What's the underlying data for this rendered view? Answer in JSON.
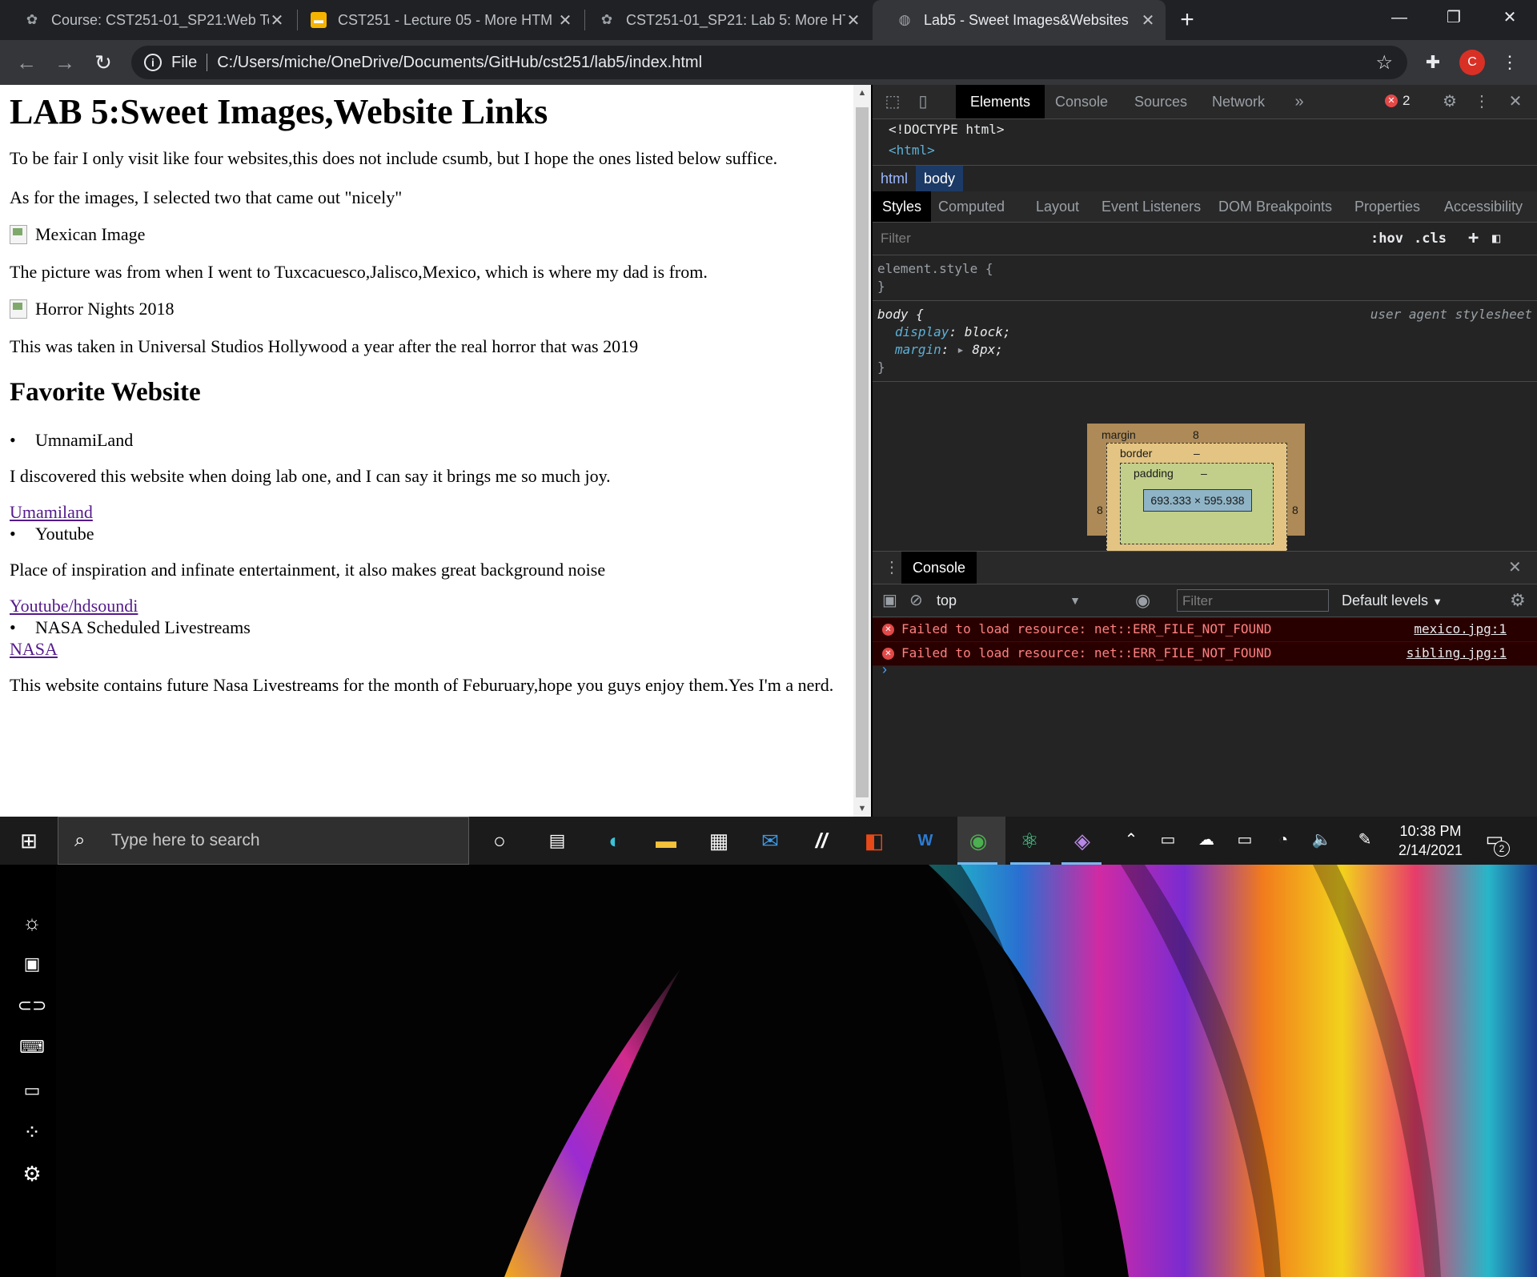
{
  "browser": {
    "tabs": [
      {
        "title": "Course: CST251-01_SP21:Web To",
        "icon": "csumb-logo-icon"
      },
      {
        "title": "CST251 - Lecture 05 - More HTM",
        "icon": "slides-icon"
      },
      {
        "title": "CST251-01_SP21: Lab 5: More HT",
        "icon": "csumb-logo-icon"
      },
      {
        "title": "Lab5 - Sweet Images&Websites",
        "icon": "globe-icon"
      }
    ],
    "address": {
      "scheme_label": "File",
      "url": "C:/Users/miche/OneDrive/Documents/GitHub/cst251/lab5/index.html"
    },
    "profile_initial": "C",
    "colors": {
      "tabstrip": "#202124",
      "toolbar": "#35363a",
      "avatar": "#d93025"
    }
  },
  "page": {
    "h1": "LAB 5:Sweet Images,Website Links",
    "intro1": "To be fair I only visit like four websites,this does not include csumb, but I hope the ones listed below suffice.",
    "intro2": "As for the images, I selected two that came out \"nicely\"",
    "img1_alt": "Mexican Image",
    "img1_caption": "The picture was from when I went to Tuxcacuesco,Jalisco,Mexico, which is where my dad is from.",
    "img2_alt": "Horror Nights 2018",
    "img2_caption": "This was taken in Universal Studios Hollywood a year after the real horror that was 2019",
    "h2": "Favorite Website",
    "sites": [
      {
        "name": "UmnamiLand",
        "desc": "I discovered this website when doing lab one, and I can say it brings me so much joy.",
        "link": "Umamiland"
      },
      {
        "name": "Youtube",
        "desc": "Place of inspiration and infinate entertainment, it also makes great background noise",
        "link": "Youtube/hdsoundi"
      },
      {
        "name": "NASA Scheduled Livestreams",
        "link": "NASA",
        "desc": "This website contains future Nasa Livestreams for the month of Feburuary,hope you guys enjoy them.Yes I'm a nerd."
      }
    ]
  },
  "devtools": {
    "tabs": [
      "Elements",
      "Console",
      "Sources",
      "Network"
    ],
    "active_tab": "Elements",
    "error_count": "2",
    "dom": {
      "doctype": "<!DOCTYPE html>",
      "html_open": "<html>"
    },
    "breadcrumbs": [
      "html",
      "body"
    ],
    "style_tabs": [
      "Styles",
      "Computed",
      "Layout",
      "Event Listeners",
      "DOM Breakpoints",
      "Properties",
      "Accessibility"
    ],
    "filter_placeholder": "Filter",
    "hov": ":hov",
    "cls": ".cls",
    "rules": {
      "element_style": "element.style {",
      "close": "}",
      "body_selector": "body {",
      "ua_label": "user agent stylesheet",
      "display_prop": "display",
      "display_val": "block;",
      "margin_prop": "margin",
      "margin_val": "8px;"
    },
    "box_model": {
      "margin_label": "margin",
      "margin_top": "8",
      "margin_left": "8",
      "margin_right": "8",
      "border_label": "border",
      "border_val": "–",
      "padding_label": "padding",
      "padding_val": "–",
      "content": "693.333 × 595.938"
    },
    "console": {
      "title": "Console",
      "context": "top",
      "filter_placeholder": "Filter",
      "levels": "Default levels",
      "messages": [
        {
          "text": "Failed to load resource: net::ERR_FILE_NOT_FOUND",
          "source": "mexico.jpg:1"
        },
        {
          "text": "Failed to load resource: net::ERR_FILE_NOT_FOUND",
          "source": "sibling.jpg:1"
        }
      ],
      "prompt": "›"
    }
  },
  "taskbar": {
    "search_placeholder": "Type here to search",
    "time": "10:38 PM",
    "date": "2/14/2021",
    "notification_count": "2"
  }
}
